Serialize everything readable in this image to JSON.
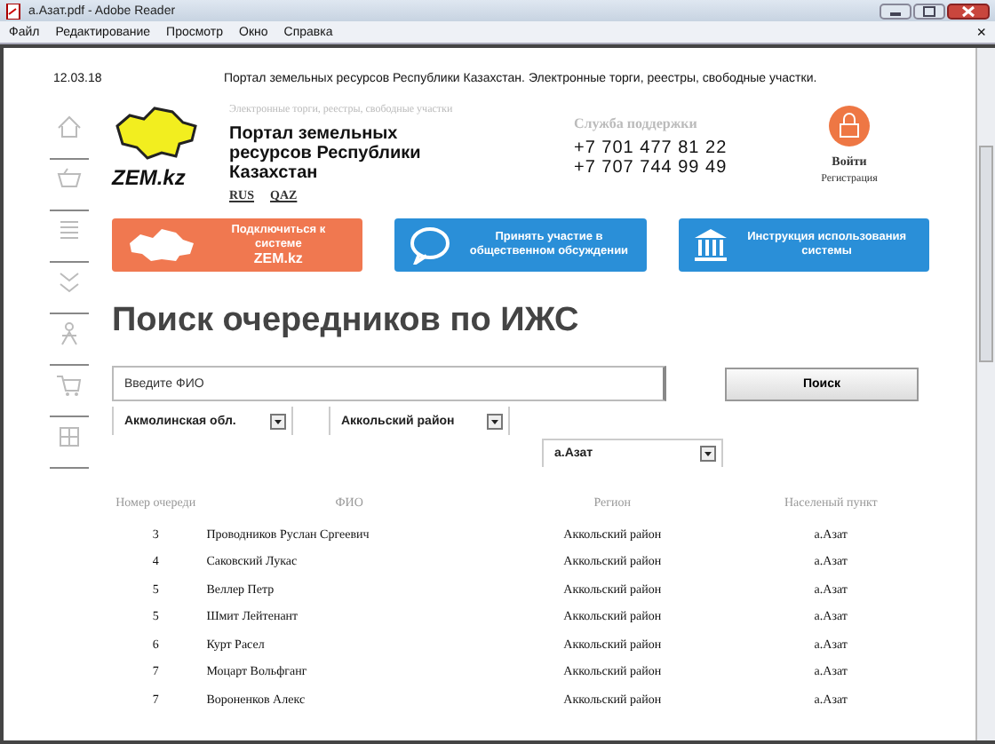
{
  "window": {
    "title": "a.Азат.pdf - Adobe Reader"
  },
  "menu": [
    "Файл",
    "Редактирование",
    "Просмотр",
    "Окно",
    "Справка"
  ],
  "doc_close": "×",
  "page": {
    "date": "12.03.18",
    "top_line": "Портал земельных ресурсов Республики Казахстан. Электронные торги, реестры, свободные участки.",
    "logo_text": "ZEM.kz",
    "tagline": "Электронные торги, реестры, свободные участки",
    "portal_title": "Портал земельных ресурсов Республики Казахстан",
    "languages": [
      "RUS",
      "QAZ"
    ],
    "support": {
      "label": "Служба поддержки",
      "phones": [
        "+7 701 477 81 22",
        "+7 707 744 99 49"
      ]
    },
    "login": "Войти",
    "register": "Регистрация",
    "banners": [
      {
        "kind": "map",
        "text": "Подключиться к системе",
        "strong": "ZEM.kz",
        "color": "#f07850"
      },
      {
        "kind": "chat",
        "text": "Принять участие в общественном обсуждении",
        "color": "#2a8fd8"
      },
      {
        "kind": "building",
        "text": "Инструкция использования системы",
        "color": "#2a8fd8"
      }
    ],
    "heading": "Поиск очередников по ИЖС",
    "search": {
      "placeholder": "Введите ФИО",
      "button": "Поиск"
    },
    "filters": [
      "Акмолинская обл.",
      "Аккольский район",
      "а.Азат"
    ],
    "table": {
      "columns": [
        "Номер очереди",
        "ФИО",
        "Регион",
        "Населеный пункт"
      ],
      "rows": [
        [
          "3",
          "Проводников Руслан Сргеевич",
          "Аккольский район",
          "а.Азат"
        ],
        [
          "4",
          "Саковский Лукас",
          "Аккольский район",
          "а.Азат"
        ],
        [
          "5",
          "Веллер Петр",
          "Аккольский район",
          "а.Азат"
        ],
        [
          "5",
          "Шмит Лейтенант",
          "Аккольский район",
          "а.Азат"
        ],
        [
          "6",
          "Курт Расел",
          "Аккольский район",
          "а.Азат"
        ],
        [
          "7",
          "Моцарт Вольфганг",
          "Аккольский район",
          "а.Азат"
        ],
        [
          "7",
          "Вороненков Алекс",
          "Аккольский район",
          "а.Азат"
        ]
      ]
    }
  }
}
